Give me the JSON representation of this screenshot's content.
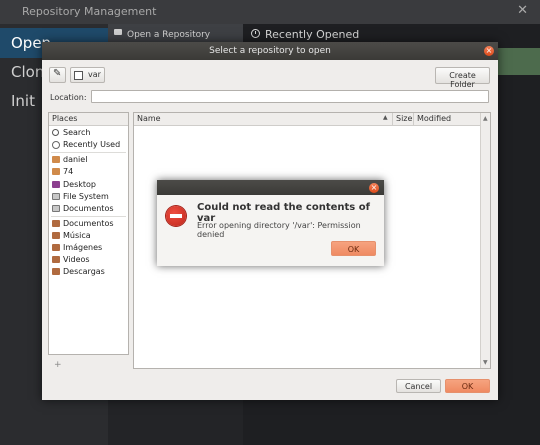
{
  "app": {
    "title": "Repository Management",
    "close_glyph": "✕",
    "sidebar": [
      "Open",
      "Clone",
      "Init"
    ],
    "open_repo_label": "Open a Repository",
    "recent_label": "Recently Opened"
  },
  "chooser": {
    "title": "Select a repository to open",
    "close_glyph": "×",
    "pencil_glyph": "✎",
    "path_button": "var",
    "create_folder": "Create Folder",
    "location_label": "Location:",
    "location_value": "",
    "places_header": "Places",
    "places": [
      {
        "label": "Search",
        "icon": "search-icon",
        "color": "#555555"
      },
      {
        "label": "Recently Used",
        "icon": "clock-icon",
        "color": "#777777"
      },
      {
        "label": "daniel",
        "icon": "home-folder-icon",
        "color": "#d08a4a"
      },
      {
        "label": "74",
        "icon": "folder-icon",
        "color": "#d08a4a"
      },
      {
        "label": "Desktop",
        "icon": "desktop-icon",
        "color": "#8c3f8f"
      },
      {
        "label": "File System",
        "icon": "drive-icon",
        "color": "#888888"
      },
      {
        "label": "Documentos",
        "icon": "drive-icon",
        "color": "#888888"
      },
      {
        "label": "Documentos",
        "icon": "documents-folder-icon",
        "color": "#b06a3f"
      },
      {
        "label": "Música",
        "icon": "music-folder-icon",
        "color": "#b06a3f"
      },
      {
        "label": "Imágenes",
        "icon": "pictures-folder-icon",
        "color": "#b06a3f"
      },
      {
        "label": "Videos",
        "icon": "videos-folder-icon",
        "color": "#b06a3f"
      },
      {
        "label": "Descargas",
        "icon": "downloads-folder-icon",
        "color": "#b06a3f"
      }
    ],
    "add_glyph": "+",
    "columns": {
      "name": "Name",
      "sort_glyph": "▲",
      "size": "Size",
      "modified": "Modified"
    },
    "scroll_up": "▲",
    "scroll_down": "▼",
    "cancel_label": "Cancel",
    "ok_label": "OK"
  },
  "error_dialog": {
    "close_glyph": "×",
    "title": "Could not read the contents of var",
    "message": "Error opening directory '/var': Permission denied",
    "ok_label": "OK",
    "icon": "error-icon"
  }
}
